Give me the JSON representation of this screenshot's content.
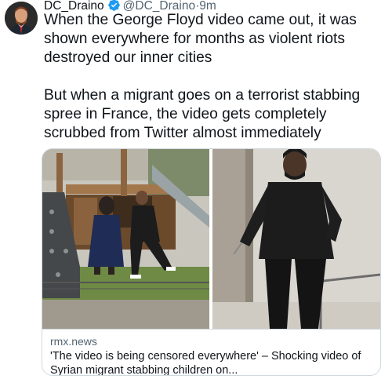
{
  "tweet": {
    "display_name": "DC_Draino",
    "handle": "@DC_Draino",
    "separator": "·",
    "time": "9m",
    "text_paragraphs": [
      "When the George Floyd video came out, it was shown everywhere for months as violent riots destroyed our inner cities",
      "But when a migrant goes on a terrorist stabbing spree in France, the video gets completely scrubbed from Twitter almost immediately"
    ]
  },
  "link_card": {
    "domain": "rmx.news",
    "title": "'The video is being censored everywhere' – Shocking video of Syrian migrant stabbing children on..."
  },
  "colors": {
    "text": "#0f1419",
    "secondary": "#536471",
    "verified_badge": "#1d9bf0",
    "border": "#cfd9de"
  },
  "icons": {
    "verified": "verified-badge-icon"
  }
}
